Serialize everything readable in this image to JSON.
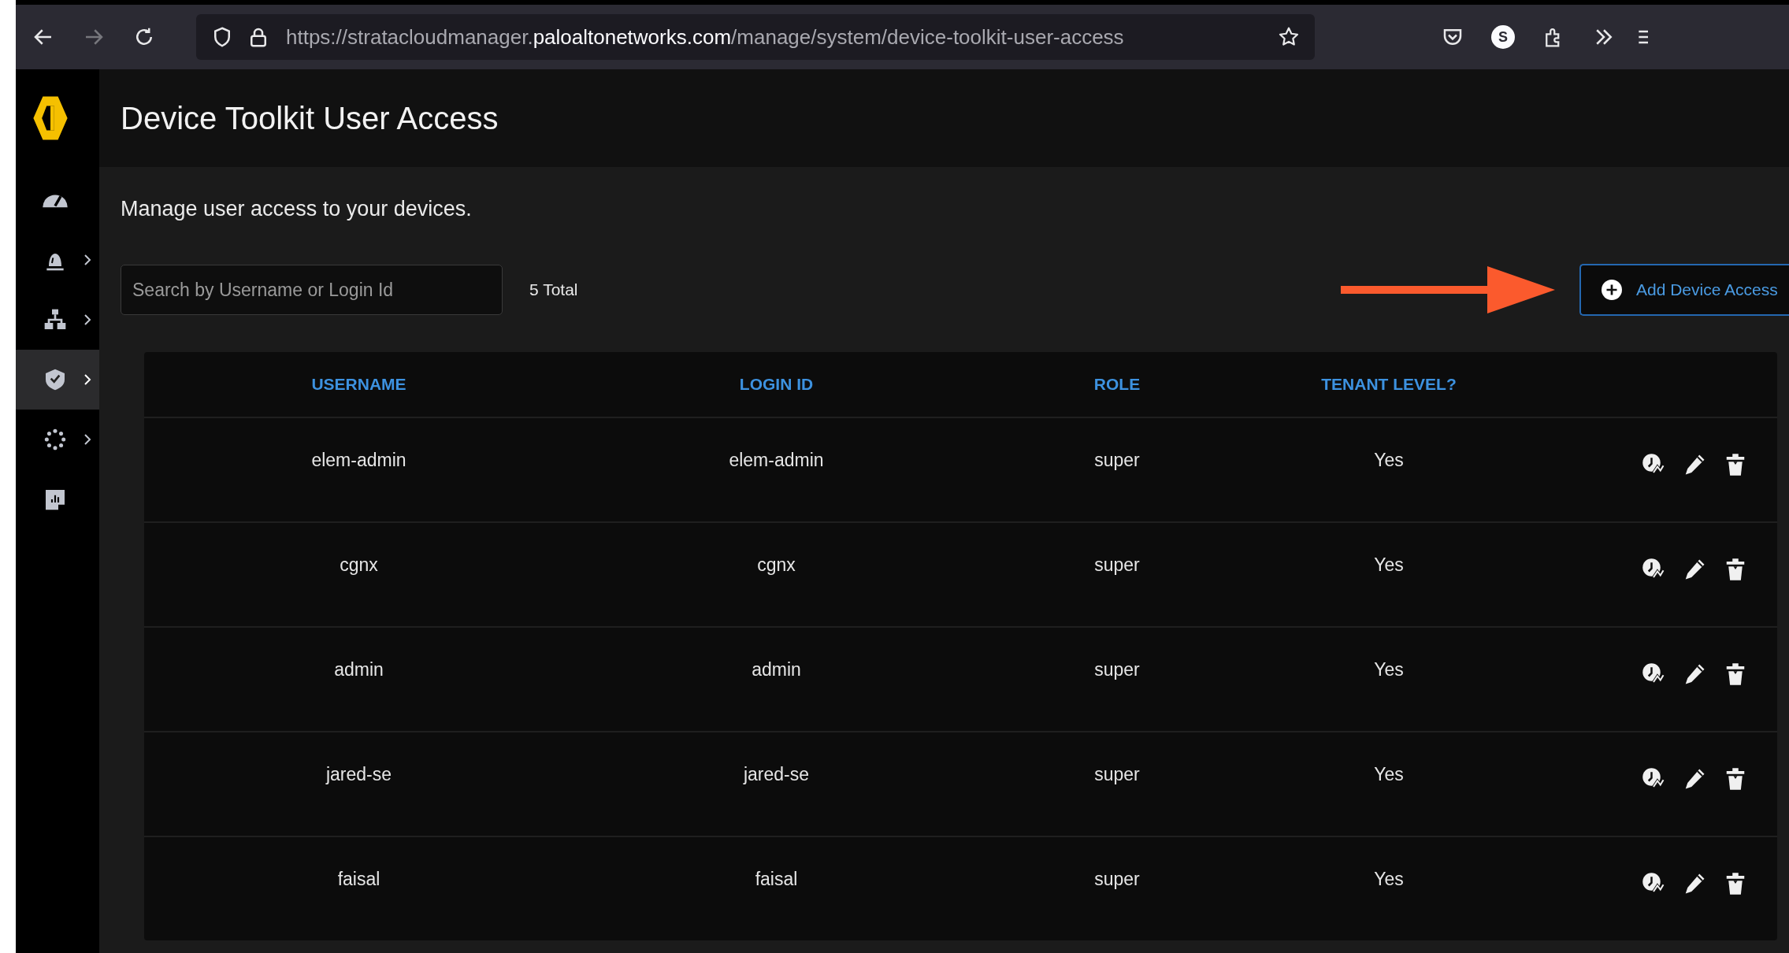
{
  "browser": {
    "url": {
      "scheme_host": "https://stratacloudmanager.",
      "domain": "paloaltonetworks.com",
      "path": "/manage/system/device-toolkit-user-access"
    },
    "profile_initial": "S"
  },
  "sidebar": {
    "items": [
      {
        "kind": "gauge",
        "has_submenu": false,
        "selected": false
      },
      {
        "kind": "alarm",
        "has_submenu": true,
        "selected": false
      },
      {
        "kind": "network",
        "has_submenu": true,
        "selected": false
      },
      {
        "kind": "shield",
        "has_submenu": true,
        "selected": true
      },
      {
        "kind": "dots",
        "has_submenu": true,
        "selected": false
      },
      {
        "kind": "report",
        "has_submenu": false,
        "selected": false
      }
    ]
  },
  "page": {
    "title": "Device Toolkit User Access",
    "description": "Manage user access to your devices.",
    "search": {
      "placeholder": "Search by Username or Login Id"
    },
    "total": "5 Total",
    "add_button": "Add Device Access"
  },
  "table": {
    "columns": [
      "USERNAME",
      "LOGIN ID",
      "ROLE",
      "TENANT LEVEL?"
    ],
    "rows": [
      {
        "username": "elem-admin",
        "login_id": "elem-admin",
        "role": "super",
        "tenant_level": "Yes"
      },
      {
        "username": "cgnx",
        "login_id": "cgnx",
        "role": "super",
        "tenant_level": "Yes"
      },
      {
        "username": "admin",
        "login_id": "admin",
        "role": "super",
        "tenant_level": "Yes"
      },
      {
        "username": "jared-se",
        "login_id": "jared-se",
        "role": "super",
        "tenant_level": "Yes"
      },
      {
        "username": "faisal",
        "login_id": "faisal",
        "role": "super",
        "tenant_level": "Yes"
      }
    ]
  }
}
